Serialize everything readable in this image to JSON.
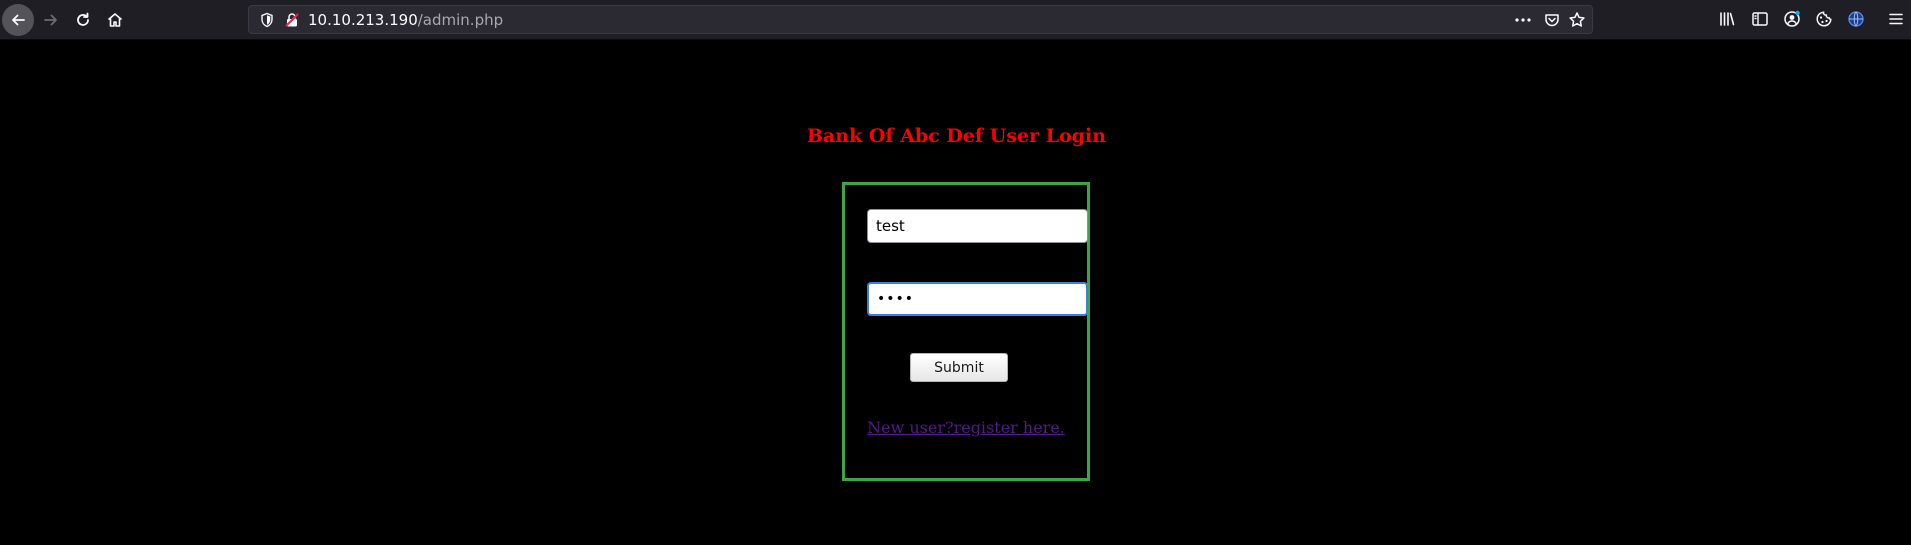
{
  "browser": {
    "url_host": "10.10.213.190",
    "url_path": "/admin.php",
    "icons": {
      "back": "back-arrow-icon",
      "forward": "forward-arrow-icon",
      "reload": "reload-icon",
      "home": "home-icon",
      "shield": "tracking-protection-shield-icon",
      "lock": "insecure-lock-icon",
      "more": "page-actions-ellipsis-icon",
      "pocket": "pocket-icon",
      "star": "bookmark-star-icon",
      "library": "library-icon",
      "sidebar": "sidebar-icon",
      "account": "account-icon",
      "cookie": "cookie-extension-icon",
      "globe": "globe-extension-icon",
      "menu": "hamburger-menu-icon"
    }
  },
  "page": {
    "title": "Bank Of Abc Def User Login",
    "title_color": "#ff0000",
    "box_border_color": "#3ca544",
    "form": {
      "username_value": "test",
      "password_value": "test",
      "submit_label": "Submit",
      "register_link": "New user?register here."
    }
  }
}
